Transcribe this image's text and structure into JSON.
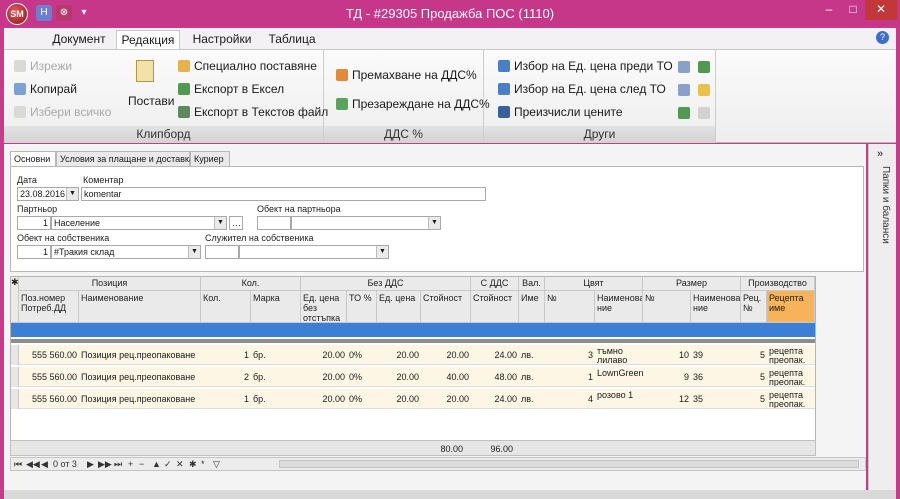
{
  "app": {
    "logo": "SM",
    "title": "ТД - #29305 Продажба ПОС (1110)",
    "help": "?"
  },
  "window": {
    "minimize": "–",
    "maximize": "□",
    "close": "✕"
  },
  "quick_access": {
    "save": "H",
    "undo": "⊗",
    "more": "▾"
  },
  "ribbon_tabs": [
    "Документ",
    "Редакция",
    "Настройки",
    "Таблица"
  ],
  "clipboard": {
    "title": "Клипборд",
    "cut": "Изрежи",
    "copy": "Копирай",
    "deselect": "Избери всичко",
    "paste": "Постави",
    "special": "Специално поставяне",
    "excel": "Експорт в Ексел",
    "text": "Експорт в Текстов файл"
  },
  "vat": {
    "title": "ДДС %",
    "remove": "Премахване на ДДС%",
    "reload": "Презареждане на ДДС%"
  },
  "other": {
    "title": "Други",
    "before": "Избор на Ед. цена преди ТО",
    "after": "Избор на Ед. цена след ТО",
    "recalc": "Преизчисли цените"
  },
  "form_tabs": [
    "Основни",
    "Условия за плащане и доставка",
    "Куриер"
  ],
  "form": {
    "date_label": "Дата",
    "date": "23.08.2016",
    "comment_label": "Коментар",
    "comment": "komentar",
    "partner_label": "Партньор",
    "partner_id": "1",
    "partner": "Население",
    "partner_obj_label": "Обект на партньора",
    "owner_obj_label": "Обект на собственика",
    "owner_obj_id": "1",
    "owner_obj": "#Тракия склад",
    "employee_label": "Служител на собственика"
  },
  "grid": {
    "groups": [
      "Позиция",
      "Кол.",
      "Без ДДС",
      "С ДДС",
      "Вал.",
      "Цвят",
      "Размер",
      "Производство"
    ],
    "columns": [
      "Поз.номер Потреб.ДД",
      "Наименование",
      "Кол.",
      "Марка",
      "Ед. цена без отстъпка",
      "ТО %",
      "Ед. цена",
      "Стойност",
      "Стойност",
      "Име",
      "№",
      "Наименова ние",
      "№",
      "Наименова ние",
      "Рец. №",
      "Рецепта име"
    ],
    "rows": [
      [
        "555 560.00",
        "Позиция рец.преопаковане",
        "1",
        "бр.",
        "20.00",
        "0%",
        "20.00",
        "20.00",
        "24.00",
        "лв.",
        "3",
        "тъмно лилаво",
        "10",
        "39",
        "5",
        "рецепта преопак."
      ],
      [
        "555 560.00",
        "Позиция рец.преопаковане",
        "2",
        "бр.",
        "20.00",
        "0%",
        "20.00",
        "40.00",
        "48.00",
        "лв.",
        "1",
        "LownGreen",
        "9",
        "36",
        "5",
        "рецепта преопак."
      ],
      [
        "555 560.00",
        "Позиция рец.преопаковане",
        "1",
        "бр.",
        "20.00",
        "0%",
        "20.00",
        "20.00",
        "24.00",
        "лв.",
        "4",
        "розово 1",
        "12",
        "35",
        "5",
        "рецепта преопак."
      ]
    ],
    "totals": [
      "80.00",
      "96.00"
    ]
  },
  "navigator": {
    "record": "0 от 3"
  },
  "side_panel": {
    "label": "Папки и баланси",
    "collapse": "»"
  }
}
